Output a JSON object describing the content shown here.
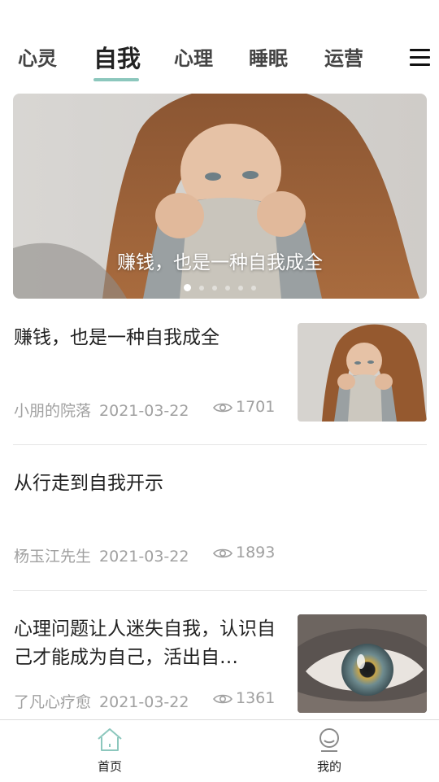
{
  "tabs": [
    {
      "label": "心灵"
    },
    {
      "label": "自我",
      "active": true
    },
    {
      "label": "心理"
    },
    {
      "label": "睡眠"
    },
    {
      "label": "运营"
    }
  ],
  "menu": {
    "icon": "menu-icon"
  },
  "banner": {
    "caption": "赚钱，也是一种自我成全",
    "slide_count": 6,
    "active_slide": 1
  },
  "articles": [
    {
      "title": "赚钱，也是一种自我成全",
      "author": "小朋的院落",
      "date": "2021-03-22",
      "views": "1701",
      "thumbnail": "woman-sweater"
    },
    {
      "title": "从行走到自我开示",
      "author": "杨玉江先生",
      "date": "2021-03-22"
    },
    {
      "title": "心理问题让人迷失自我，认识自己才能成为自己，活出自…",
      "author": "了凡心疗愈",
      "date": "2021-03-22",
      "views": "1361",
      "thumbnail": "eye-closeup"
    }
  ],
  "bottom_nav": [
    {
      "label": "首页",
      "icon": "home-icon",
      "active": true
    },
    {
      "label": "我的",
      "icon": "profile-icon"
    }
  ],
  "colors": {
    "accent": "#8cc7bd",
    "meta_text": "#a0a0a0",
    "title_text": "#222222"
  }
}
